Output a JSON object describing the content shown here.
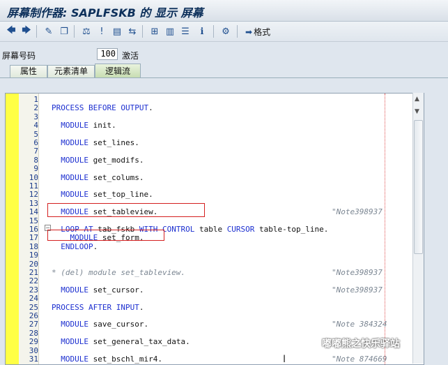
{
  "window": {
    "title": "屏幕制作器: SAPLFSKB 的 显示 屏幕"
  },
  "toolbar": {
    "icons": [
      "back-icon",
      "forward-icon",
      "display-change-icon",
      "other-object-icon",
      "check-icon",
      "activate-icon",
      "where-used-icon",
      "navigate-icon",
      "hierarchy-icon",
      "layout-icon",
      "element-list-icon",
      "info-icon",
      "settings-icon"
    ],
    "format_label": "格式"
  },
  "screen": {
    "label": "屏幕号码",
    "number": "100",
    "status": "激活"
  },
  "tabs": [
    {
      "label": "属性"
    },
    {
      "label": "元素清单"
    },
    {
      "label": "逻辑流",
      "active": true
    }
  ],
  "editor": {
    "lines": [
      {
        "n": "1",
        "code": ""
      },
      {
        "n": "2",
        "code": "PROCESS BEFORE OUTPUT."
      },
      {
        "n": "3",
        "code": ""
      },
      {
        "n": "4",
        "code": "  MODULE init."
      },
      {
        "n": "5",
        "code": ""
      },
      {
        "n": "6",
        "code": "  MODULE set_lines."
      },
      {
        "n": "7",
        "code": ""
      },
      {
        "n": "8",
        "code": "  MODULE get_modifs."
      },
      {
        "n": "9",
        "code": ""
      },
      {
        "n": "10",
        "code": "  MODULE set_colums."
      },
      {
        "n": "11",
        "code": ""
      },
      {
        "n": "12",
        "code": "  MODULE set_top_line."
      },
      {
        "n": "13",
        "code": ""
      },
      {
        "n": "14",
        "code": "  MODULE set_tableview.",
        "note": "\"Note398937"
      },
      {
        "n": "15",
        "code": ""
      },
      {
        "n": "16",
        "code": "  LOOP AT tab_fskb WITH CONTROL table CURSOR table-top_line."
      },
      {
        "n": "17",
        "code": "    MODULE set_form."
      },
      {
        "n": "18",
        "code": "  ENDLOOP."
      },
      {
        "n": "19",
        "code": ""
      },
      {
        "n": "20",
        "code": ""
      },
      {
        "n": "21",
        "code": "* (del) module set_tableview.",
        "note": "\"Note398937"
      },
      {
        "n": "22",
        "code": ""
      },
      {
        "n": "23",
        "code": "  MODULE set_cursor.",
        "note": "\"Note398937"
      },
      {
        "n": "24",
        "code": ""
      },
      {
        "n": "25",
        "code": "PROCESS AFTER INPUT."
      },
      {
        "n": "26",
        "code": ""
      },
      {
        "n": "27",
        "code": "  MODULE save_cursor.",
        "note": "\"Note 384324"
      },
      {
        "n": "28",
        "code": ""
      },
      {
        "n": "29",
        "code": "  MODULE set_general_tax_data."
      },
      {
        "n": "30",
        "code": ""
      },
      {
        "n": "31",
        "code": "  MODULE set_bschl_mir4.",
        "note": "\"Note 874669"
      }
    ]
  },
  "watermark": "嘟嘟熊之快乐驿站",
  "colors": {
    "keyword": "#1c2fd0",
    "comment": "#7c8793",
    "highlight_box": "#d42020",
    "gutter": "#ffff44"
  }
}
